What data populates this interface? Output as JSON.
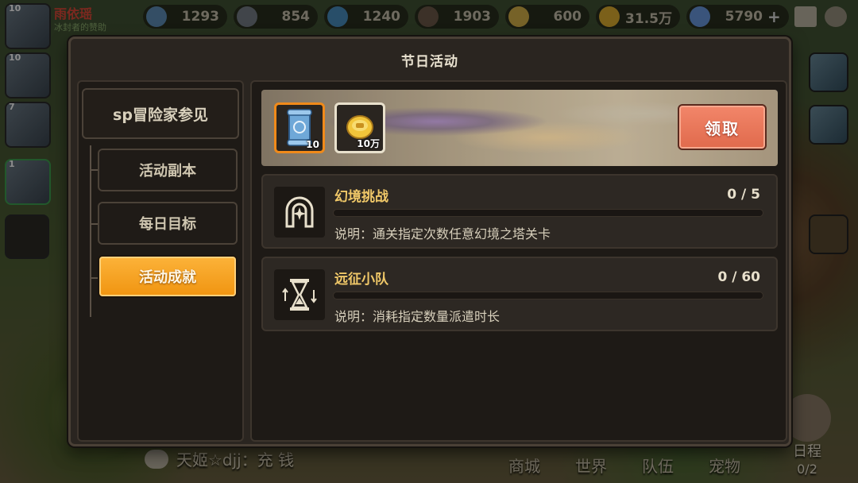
{
  "resources": [
    {
      "name": "ore",
      "value": "1293",
      "color": "#5f8fb8"
    },
    {
      "name": "stone",
      "value": "854",
      "color": "#777f88"
    },
    {
      "name": "crystal",
      "value": "1240",
      "color": "#4a8fc0"
    },
    {
      "name": "wood",
      "value": "1903",
      "color": "#6d5a4a"
    },
    {
      "name": "wheat",
      "value": "600",
      "color": "#d8b24a"
    },
    {
      "name": "gold",
      "value": "31.5万",
      "color": "#e0b030"
    },
    {
      "name": "diamond",
      "value": "5790",
      "color": "#6a9ae0"
    }
  ],
  "player": {
    "name": "雨依瑶",
    "sub": "冰封者的赞助",
    "level": "10"
  },
  "portraits": [
    {
      "level": "10"
    },
    {
      "level": "10"
    },
    {
      "level": "7"
    },
    {
      "level": "1"
    }
  ],
  "modal": {
    "title": "节日活动",
    "category": "sp冒险家参见",
    "tabs": [
      {
        "label": "活动副本",
        "active": false
      },
      {
        "label": "每日目标",
        "active": false
      },
      {
        "label": "活动成就",
        "active": true
      }
    ],
    "rewards": [
      {
        "icon": "scroll-icon",
        "qty": "10"
      },
      {
        "icon": "gold-coin-icon",
        "qty": "10万"
      }
    ],
    "claim_label": "领取",
    "tasks": [
      {
        "title": "幻境挑战",
        "progress_text": "0 / 5",
        "progress": 0,
        "desc": "说明：通关指定次数任意幻境之塔关卡",
        "icon": "horseshoe-icon"
      },
      {
        "title": "远征小队",
        "progress_text": "0 / 60",
        "progress": 0,
        "desc": "说明：消耗指定数量派遣时长",
        "icon": "hourglass-icon"
      }
    ]
  },
  "chat": {
    "text": "天姬☆djj：充 钱"
  },
  "nav": [
    "商城",
    "世界",
    "队伍",
    "宠物"
  ],
  "schedule": {
    "label": "日程",
    "count": "0/2"
  }
}
